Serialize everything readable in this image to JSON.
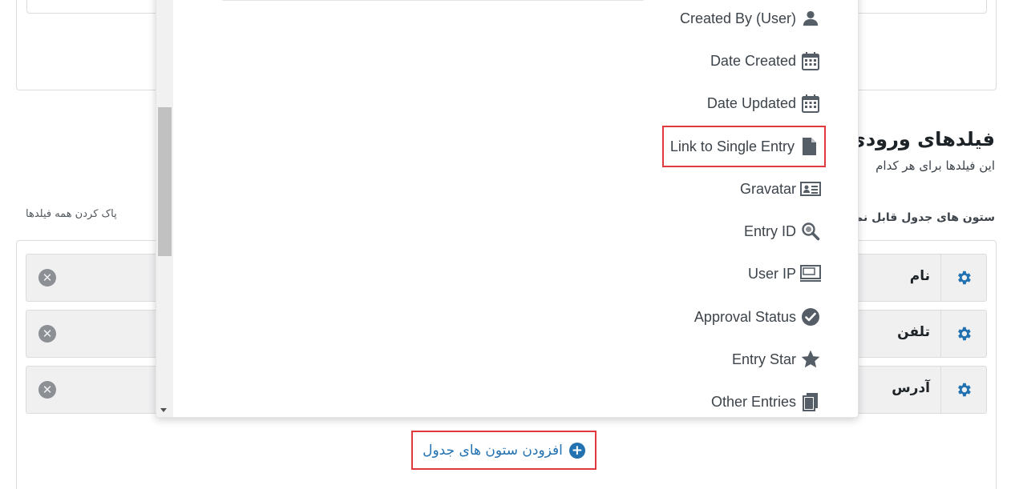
{
  "page": {
    "section_title": "فیلدهای ورودی",
    "section_description": "این فیلدها برای هر کدام",
    "clear_all_label": "پاک کردن همه فیلدها",
    "columns_label": "ستون های جدول قابل نمای",
    "add_columns_label": "افزودن ستون های جدول"
  },
  "fields": [
    {
      "name": "نام"
    },
    {
      "name": "تلفن"
    },
    {
      "name": "آدرس"
    }
  ],
  "dropdown": {
    "items": [
      {
        "label": "Created By (User)",
        "icon": "user-icon"
      },
      {
        "label": "Date Created",
        "icon": "calendar-icon"
      },
      {
        "label": "Date Updated",
        "icon": "calendar-icon"
      },
      {
        "label": "Link to Single Entry",
        "icon": "document-icon",
        "highlighted": true
      },
      {
        "label": "Gravatar",
        "icon": "id-card-icon"
      },
      {
        "label": "Entry ID",
        "icon": "search-icon"
      },
      {
        "label": "User IP",
        "icon": "monitor-icon"
      },
      {
        "label": "Approval Status",
        "icon": "check-circle-icon"
      },
      {
        "label": "Entry Star",
        "icon": "star-icon"
      },
      {
        "label": "Other Entries",
        "icon": "copy-icon"
      }
    ]
  },
  "colors": {
    "accent": "#2271b1",
    "highlight_border": "#e0393e",
    "icon_gray": "#555d66"
  }
}
